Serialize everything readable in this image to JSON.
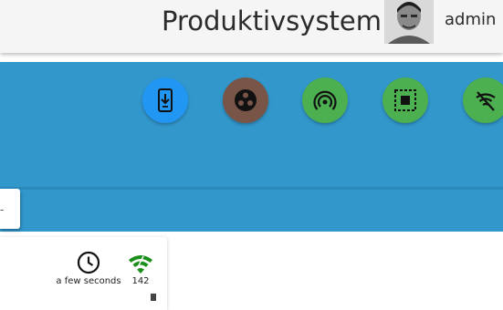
{
  "header": {
    "app_title": "Produktivsystem",
    "username": "admin"
  },
  "action_buttons": [
    {
      "icon": "phone-download-icon",
      "color": "#2196f3"
    },
    {
      "icon": "three-dots-circle-icon",
      "color": "#795548"
    },
    {
      "icon": "broadcast-signal-icon",
      "color": "#4caf50"
    },
    {
      "icon": "chip-select-icon",
      "color": "#4caf50"
    },
    {
      "icon": "wifi-off-icon",
      "color": "#4caf50"
    }
  ],
  "side_tab": {
    "label": "-"
  },
  "status_card": {
    "last_seen_icon": "clock-icon",
    "last_seen": "a few seconds",
    "signal_icon": "wifi-icon",
    "signal_color": "#1a8f1a",
    "signal_value": "142"
  },
  "colors": {
    "band": "#3297cb",
    "topbar": "#f5f5f5"
  }
}
